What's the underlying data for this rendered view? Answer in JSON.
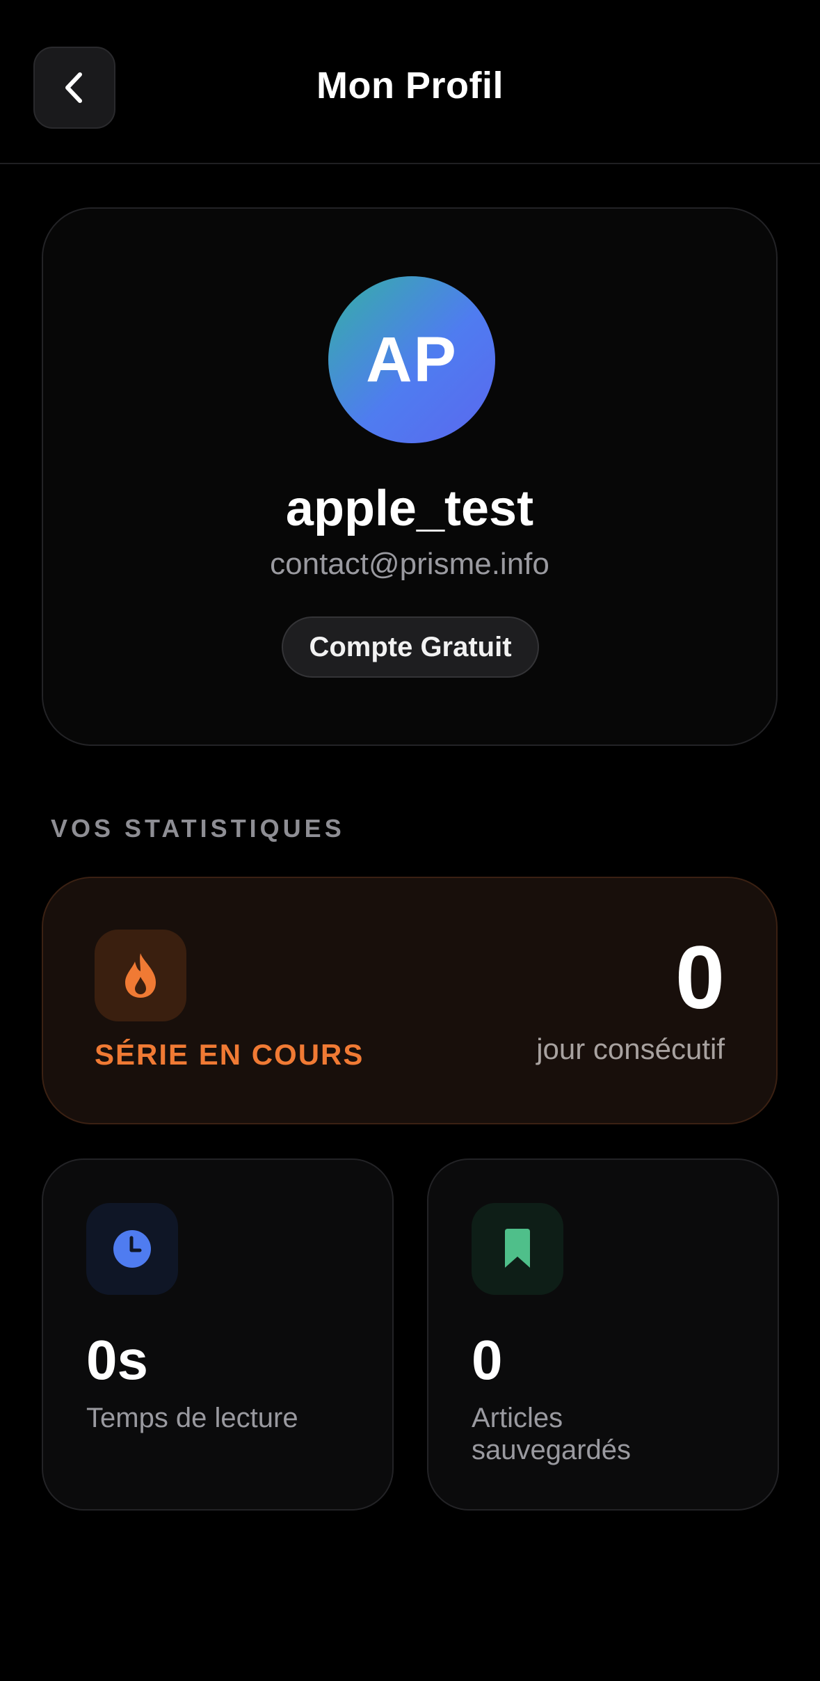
{
  "header": {
    "title": "Mon Profil",
    "back_icon": "chevron-left-icon"
  },
  "profile": {
    "avatar_initials": "AP",
    "username": "apple_test",
    "email": "contact@prisme.info",
    "plan_badge": "Compte Gratuit"
  },
  "stats": {
    "section_title": "VOS STATISTIQUES",
    "streak": {
      "icon": "flame-icon",
      "label": "SÉRIE EN COURS",
      "value": "0",
      "unit": "jour consécutif"
    },
    "reading_time": {
      "icon": "clock-icon",
      "value": "0s",
      "label": "Temps de lecture"
    },
    "saved_articles": {
      "icon": "bookmark-icon",
      "value": "0",
      "label": "Articles sauvegardés"
    }
  },
  "colors": {
    "background": "#000000",
    "accent_orange": "#f07a34",
    "accent_blue": "#4f7cf0",
    "accent_green": "#4fbf8a"
  }
}
